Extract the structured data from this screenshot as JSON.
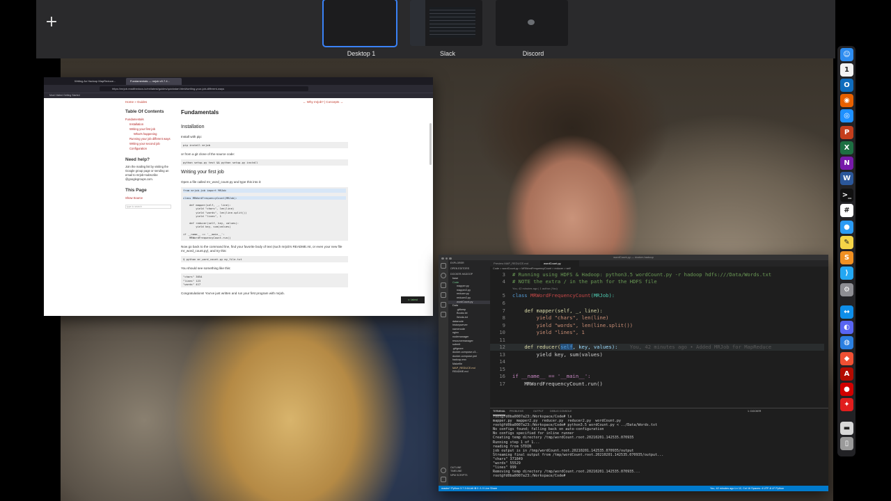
{
  "spaces": {
    "add_icon": "+",
    "items": [
      {
        "label": "Desktop 1"
      },
      {
        "label": "Slack"
      },
      {
        "label": "Discord"
      }
    ]
  },
  "browser": {
    "tabs": [
      "Writing An Hadoop MapReduce...",
      "Fundamentals — mrjob v0.7.4..."
    ],
    "url": "https://mrjob.readthedocs.io/en/latest/guides/quickstart.html#writing-your-job-different-ways",
    "bookmarks": "Most Visited   Getting Started",
    "breadcrumb_left": "Home » Guides",
    "breadcrumb_right": "← Why mrjob? | Concepts →",
    "toc_title": "Table Of Contents",
    "toc": [
      {
        "label": "Fundamentals",
        "level": 0
      },
      {
        "label": "Installation",
        "level": 1
      },
      {
        "label": "Writing your first job",
        "level": 1
      },
      {
        "label": "What's happening",
        "level": 2
      },
      {
        "label": "Running your job different ways",
        "level": 1
      },
      {
        "label": "Writing your second job",
        "level": 1
      },
      {
        "label": "Configuration",
        "level": 1
      }
    ],
    "help_title": "Need help?",
    "help_text": "Join the mailing list by visiting the Google group page or sending an email to mrjob+subscribe @googlegroups.com.",
    "this_page_title": "This Page",
    "show_source": "Show Source",
    "search_placeholder": "type to search",
    "h1": "Fundamentals",
    "h2_install": "Installation",
    "p_install": "Install with pip:",
    "code_pip": "pip install mrjob",
    "p_git": "or from a git clone of the source code:",
    "code_setup": "python setup.py test && python setup.py install",
    "h2_first": "Writing your first job",
    "p_open": "Open a file called mr_word_count.py and type this into it:",
    "code_job": [
      "from mrjob.job import MRJob",
      "",
      "class MRWordFrequencyCount(MRJob):",
      "",
      "    def mapper(self, _, line):",
      "        yield \"chars\", len(line)",
      "        yield \"words\", len(line.split())",
      "        yield \"lines\", 1",
      "",
      "    def reducer(self, key, values):",
      "        yield key, sum(values)",
      "",
      "if __name__ == '__main__':",
      "    MRWordFrequencyCount.run()"
    ],
    "p_back": "Now go back to the command line, find your favorite body of text (such mrjob's README.rst, or even your new file mr_word_count.py), and try this:",
    "code_run": "$ python mr_word_count.py my_file.txt",
    "p_see": "You should see something like this:",
    "code_out": [
      "\"chars\" 3654",
      "\"lines\" 123",
      "\"words\" 417"
    ],
    "p_congrats": "Congratulations! You've just written and run your first program with mrjob.",
    "rtd_badge": "v: latest"
  },
  "vscode": {
    "title": "wordCount.py — docker-hadoop",
    "tabs": [
      "Preview MAP_REDUCE.md",
      "wordCount.py"
    ],
    "breadcrumb": "Code > wordCount.py > MRWordFrequencyCount > reducer > self",
    "sidebar_header": "EXPLORER",
    "open_editors": "OPEN EDITORS",
    "workspace": "DOCKER-HADOOP",
    "tree": [
      {
        "label": "base",
        "cls": ""
      },
      {
        "label": "Code",
        "cls": "git"
      },
      {
        "label": "mapper.py",
        "cls": ""
      },
      {
        "label": "mapper2.py",
        "cls": ""
      },
      {
        "label": "reducer.py",
        "cls": ""
      },
      {
        "label": "reducer2.py",
        "cls": ""
      },
      {
        "label": "wordCount.py",
        "cls": "sel"
      },
      {
        "label": "Data",
        "cls": ""
      },
      {
        "label": ".gitkeep",
        "cls": ""
      },
      {
        "label": "Books.txt",
        "cls": ""
      },
      {
        "label": "Words.txt",
        "cls": ""
      },
      {
        "label": "datanode",
        "cls": ""
      },
      {
        "label": "historyserver",
        "cls": ""
      },
      {
        "label": "namenode",
        "cls": ""
      },
      {
        "label": "nginx",
        "cls": ""
      },
      {
        "label": "nodemanager",
        "cls": ""
      },
      {
        "label": "resourcemanager",
        "cls": ""
      },
      {
        "label": "submit",
        "cls": ""
      },
      {
        "label": ".gitignore",
        "cls": ""
      },
      {
        "label": "docker-compose-v3...",
        "cls": ""
      },
      {
        "label": "docker-compose.yml",
        "cls": ""
      },
      {
        "label": "hadoop.env",
        "cls": ""
      },
      {
        "label": "Makefile",
        "cls": ""
      },
      {
        "label": "MAP_REDUCE.md",
        "cls": "mod"
      },
      {
        "label": "README.md",
        "cls": ""
      }
    ],
    "outline": [
      "OUTLINE",
      "TIMELINE",
      "NPM SCRIPTS"
    ],
    "code": {
      "l3": "# Running using HDFS & Hadoop: python3.5 wordCount.py -r hadoop hdfs:///Data/Words.txt",
      "l4": "# NOTE the extra / in the path for the HDFS file",
      "blame_top": "You, 42 minutes ago | 1 author (You)",
      "l5_kw": "class",
      "l5_name": "MRWordFrequencyCount",
      "l5_arg": "(MRJob):",
      "l7": "def mapper(self, _, line):",
      "l8": "yield \"chars\", len(line)",
      "l9": "yield \"words\", len(line.split())",
      "l10": "yield \"lines\", 1",
      "l12_a": "def reducer(",
      "l12_self": "self",
      "l12_b": ", key, values):",
      "l12_blame": "You, 42 minutes ago • Added MRJob for MapReduce",
      "l13": "yield key, sum(values)",
      "l16": "if __name__ == '__main__':",
      "l17": "MRWordFrequencyCount.run()",
      "nums": [
        "3",
        "4",
        "5",
        "6",
        "7",
        "8",
        "9",
        "10",
        "11",
        "12",
        "13",
        "14",
        "15",
        "16",
        "17"
      ]
    },
    "panel_tabs": [
      "TERMINAL",
      "PROBLEMS",
      "OUTPUT",
      "DEBUG CONSOLE"
    ],
    "terminal_select": "1: docker",
    "terminal": [
      "root@fd0ba0007a23:/Workspace/Code# ls",
      "mapper.py  mapper2.py  reducer.py  reducer2.py  wordCount.py",
      "root@fd0ba0007a23:/Workspace/Code# python3.5 wordCount.py < ../Data/Words.txt",
      "No configs found; falling back on auto-configuration",
      "No configs specified for inline runner",
      "Creating temp directory /tmp/wordCount.root.20210201.142535.070935",
      "Running step 1 of 1...",
      "reading from STDIN",
      "job output is in /tmp/wordCount.root.20210201.142535.070935/output",
      "Streaming final output from /tmp/wordCount.root.20210201.142535.070935/output...",
      "\"chars\" 371849",
      "\"words\" 55529",
      "\"lines\" 999",
      "Removing temp directory /tmp/wordCount.root.20210201.142535.070935...",
      "root@fd0ba0007a23:/Workspace/Code# "
    ],
    "status_left": "master*   Python 3.7.3 64-bit   ⊗ 0 ⚠ 0   Live Share",
    "status_right": "You, 42 minutes ago   Ln 12, Col 16   Spaces: 4   UTF-8   LF   Python"
  },
  "dock": [
    {
      "name": "finder-icon",
      "glyph": "☺",
      "color": "#2d8cf0"
    },
    {
      "name": "calendar-icon",
      "glyph": "1",
      "color": "#f2f2f2"
    },
    {
      "name": "outlook-icon",
      "glyph": "O",
      "color": "#0f6cbd"
    },
    {
      "name": "firefox-icon",
      "glyph": "◉",
      "color": "#e66000"
    },
    {
      "name": "safari-icon",
      "glyph": "◎",
      "color": "#1e90ff"
    },
    {
      "name": "powerpoint-icon",
      "glyph": "P",
      "color": "#c43e1c"
    },
    {
      "name": "excel-icon",
      "glyph": "X",
      "color": "#1d6f42"
    },
    {
      "name": "onenote-icon",
      "glyph": "N",
      "color": "#7719aa"
    },
    {
      "name": "word-icon",
      "glyph": "W",
      "color": "#2b579a"
    },
    {
      "name": "terminal-icon",
      "glyph": ">_",
      "color": "#111111"
    },
    {
      "name": "slack-icon",
      "glyph": "#",
      "color": "#ffffff"
    },
    {
      "name": "messages-icon",
      "glyph": "●",
      "color": "#2b9bf4"
    },
    {
      "name": "notes-icon",
      "glyph": "✎",
      "color": "#f5d547"
    },
    {
      "name": "sublime-icon",
      "glyph": "S",
      "color": "#f09022"
    },
    {
      "name": "vscode-icon",
      "glyph": "⟩",
      "color": "#23a7f2"
    },
    {
      "name": "settings-icon",
      "glyph": "⚙",
      "color": "#8e8e93"
    },
    {
      "name": "teamviewer-icon",
      "glyph": "↔",
      "color": "#0e8ee9"
    },
    {
      "name": "discord-icon",
      "glyph": "◐",
      "color": "#5865f2"
    },
    {
      "name": "chat-icon",
      "glyph": "◍",
      "color": "#2b7fe0"
    },
    {
      "name": "git-icon",
      "glyph": "◆",
      "color": "#f05033"
    },
    {
      "name": "acrobat-icon",
      "glyph": "A",
      "color": "#b30b00"
    },
    {
      "name": "record-icon",
      "glyph": "●",
      "color": "#d00000"
    },
    {
      "name": "app-icon",
      "glyph": "✦",
      "color": "#e11d1d"
    },
    {
      "name": "drive-icon",
      "glyph": "▬",
      "color": "#d8d8d8"
    },
    {
      "name": "trash-icon",
      "glyph": "▯",
      "color": "#9a9a9a"
    }
  ]
}
